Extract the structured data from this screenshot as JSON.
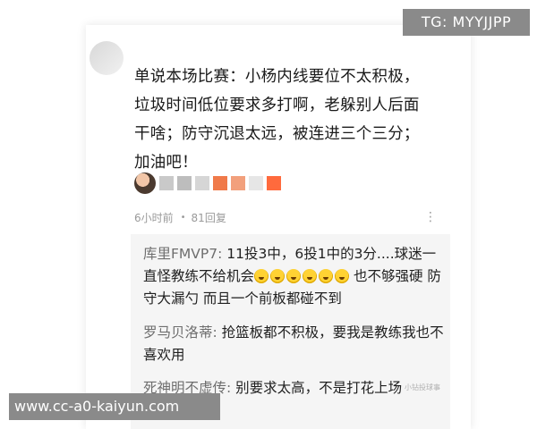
{
  "watermark_tg": "TG: MYYJJPP",
  "watermark_site": "www.cc-a0-kaiyun.com",
  "watermark_small": "小钻投球事",
  "comment": {
    "text": "单说本场比赛：小杨内线要位不太积极，垃圾时间低位要求多打啊，老躲别人后面干啥；防守沉退太远，被连进三个三分；加油吧！"
  },
  "meta": {
    "time": "6小时前",
    "dot": "•",
    "reply_count": "81回复",
    "more_icon": "⋮"
  },
  "replies": [
    {
      "name": "库里FMVP7:",
      "text_a": " 11投3中，6投1中的3分....球迷一直怪教练不给机会",
      "emoji_count": 6,
      "text_b": " 也不够强硬 防守大漏勺 而且一个前板都碰不到"
    },
    {
      "name": "罗马贝洛蒂:",
      "text_a": " 抢篮板都不积极，要我是教练我也不喜欢用"
    },
    {
      "name": "死神明不虚传:",
      "text_a": " 别要求太高，不是打花上场"
    }
  ],
  "colors": {
    "watermark_bg": "#8a8a8a",
    "reply_bg": "#f5f5f5",
    "meta_text": "#9a9a9a"
  }
}
